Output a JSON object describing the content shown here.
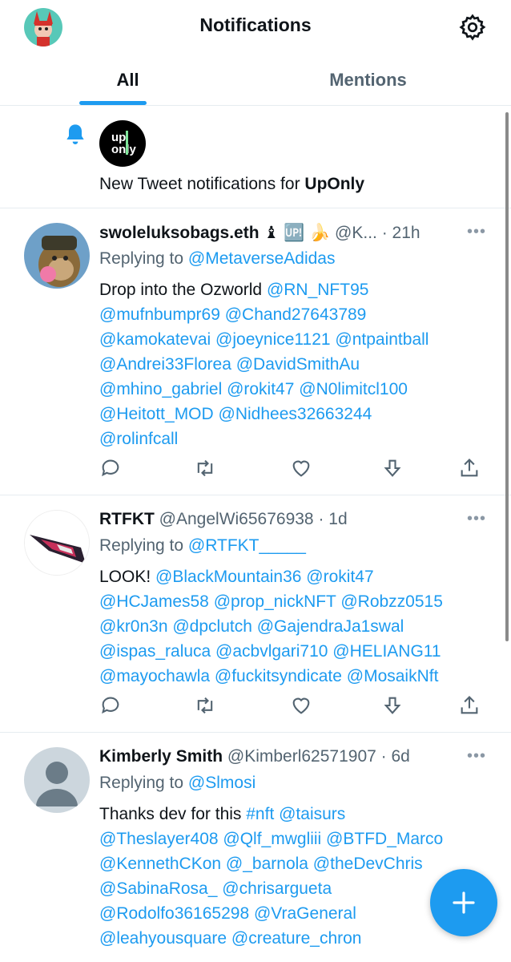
{
  "header": {
    "title": "Notifications"
  },
  "tabs": [
    {
      "label": "All",
      "active": true
    },
    {
      "label": "Mentions",
      "active": false
    }
  ],
  "new_tweet_notification": {
    "text_prefix": "New Tweet notifications for ",
    "account": "UpOnly",
    "logo_text_1": "up",
    "logo_text_2": "only"
  },
  "tweets": [
    {
      "name": "swoleluksobags.eth",
      "badges": "♝ 🆙 🍌",
      "handle_time": " @K... · 21h",
      "replying_prefix": "Replying to ",
      "replying_to": "@MetaverseAdidas",
      "body_lines": [
        [
          "Drop into the Ozworld ",
          "@RN_NFT95"
        ],
        [
          "",
          "@mufnbumpr69 @Chand27643789"
        ],
        [
          "",
          "@kamokatevai @joeynice1121 @ntpaintball"
        ],
        [
          "",
          "@Andrei33Florea @DavidSmithAu"
        ],
        [
          "",
          "@mhino_gabriel @rokit47 @N0limitcl100"
        ],
        [
          "",
          "@Heitott_MOD @Nidhees32663244"
        ],
        [
          "",
          "@rolinfcall"
        ]
      ]
    },
    {
      "name": "RTFKT",
      "badges": "",
      "handle_time": " @AngelWi65676938 · 1d",
      "replying_prefix": "Replying to ",
      "replying_to": "@RTFKT_____",
      "body_lines": [
        [
          "LOOK! ",
          "@BlackMountain36 @rokit47"
        ],
        [
          "",
          "@HCJames58 @prop_nickNFT @Robzz0515"
        ],
        [
          "",
          "@kr0n3n @dpclutch @GajendraJa1swal"
        ],
        [
          "",
          "@ispas_raluca @acbvlgari710 @HELIANG11"
        ],
        [
          "",
          "@mayochawla @fuckitsyndicate @MosaikNft"
        ]
      ]
    },
    {
      "name": "Kimberly Smith",
      "badges": "",
      "handle_time": " @Kimberl62571907 · 6d",
      "replying_prefix": "Replying to ",
      "replying_to": "@Slmosi",
      "body_lines": [
        [
          "Thanks dev for this ",
          "#nft @taisurs"
        ],
        [
          "",
          "@Theslayer408 @Qlf_mwgliii @BTFD_Marco"
        ],
        [
          "",
          "@KennethCKon @_barnola @theDevChris"
        ],
        [
          "",
          "@SabinaRosa_ @chrisargueta"
        ],
        [
          "",
          "@Rodolfo36165298 @VraGeneral"
        ],
        [
          "",
          "@leahyousquare @creature_chron"
        ]
      ]
    }
  ],
  "more_menu_glyph": "•••",
  "colors": {
    "accent": "#1d9bf0",
    "text": "#0f1419",
    "secondary": "#536471"
  }
}
